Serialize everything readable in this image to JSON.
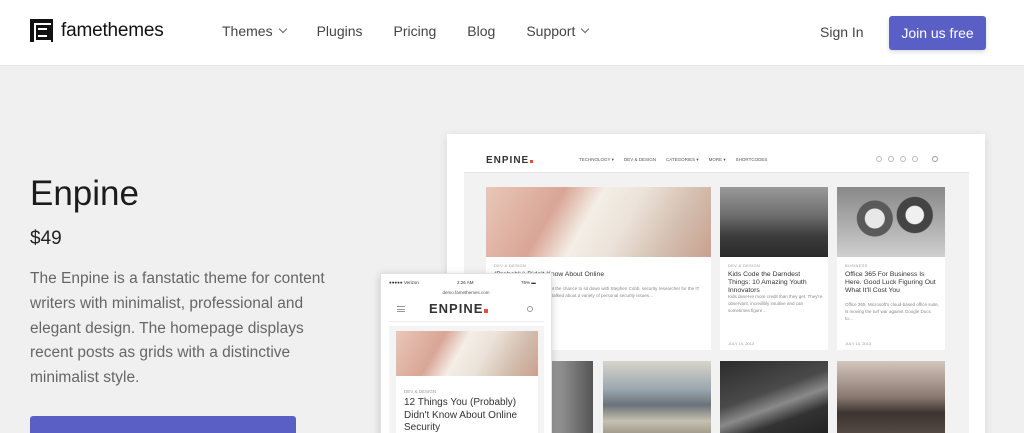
{
  "header": {
    "brand": "famethemes",
    "nav": [
      {
        "label": "Themes",
        "dropdown": true
      },
      {
        "label": "Plugins",
        "dropdown": false
      },
      {
        "label": "Pricing",
        "dropdown": false
      },
      {
        "label": "Blog",
        "dropdown": false
      },
      {
        "label": "Support",
        "dropdown": true
      }
    ],
    "sign_in": "Sign In",
    "join": "Join us free",
    "accent": "#5a5fc6"
  },
  "product": {
    "title": "Enpine",
    "price": "$49",
    "description": "The Enpine is a fanstatic theme for content writers with minimalist, professional and elegant design. The homepage displays recent posts as grids with a distinctive minimalist style."
  },
  "preview_desktop": {
    "logo": "ENPINE",
    "menu": [
      "TECHNOLOGY ▾",
      "DEV & DESIGN",
      "CATEGORIES ▾",
      "MORE ▾",
      "SHORTCODES"
    ],
    "cards": [
      {
        "category": "DEV & DESIGN",
        "title": "(Probably) Didn't Know About Online",
        "excerpt": "San Francisco last week, I got the chance to sit down with Stephen Cobb, security researcher for the IT security company ESET. We talked about a variety of personal security issues…",
        "date": ""
      },
      {
        "category": "DEV & DESIGN",
        "title": "Kids Code the Darndest Things: 10 Amazing Youth Innovators",
        "excerpt": "Kids deserve more credit than they get. They're observant, incredibly intuitive and can sometimes figure…",
        "date": "JULY 14, 2013"
      },
      {
        "category": "BUSINESS",
        "title": "Office 365 For Business Is Here. Good Luck Figuring Out What It'll Cost You",
        "excerpt": "Office 365, Microsoft's cloud-based office suite, is moving the turf war against Google Docs to…",
        "date": "JULY 14, 2013"
      }
    ]
  },
  "preview_mobile": {
    "carrier": "●●●●● Verizon",
    "time": "2:26 AM",
    "battery": "76% ▬",
    "url": "demo.famethemes.com",
    "logo": "ENPINE",
    "category": "DEV & DESIGN",
    "title": "12 Things You (Probably) Didn't Know About Online Security"
  }
}
